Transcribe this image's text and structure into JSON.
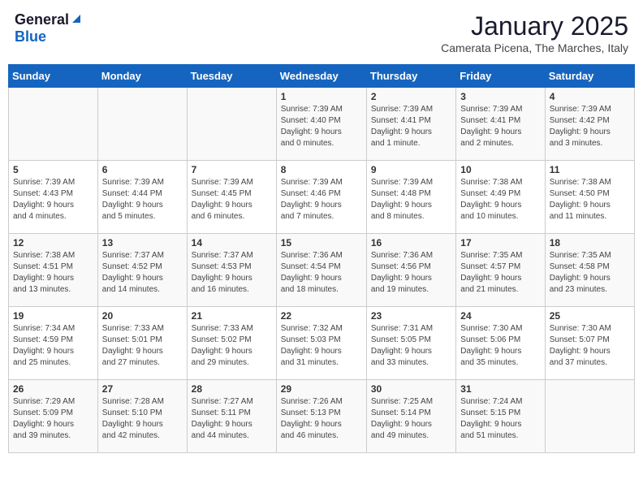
{
  "header": {
    "logo_general": "General",
    "logo_blue": "Blue",
    "title": "January 2025",
    "subtitle": "Camerata Picena, The Marches, Italy"
  },
  "weekdays": [
    "Sunday",
    "Monday",
    "Tuesday",
    "Wednesday",
    "Thursday",
    "Friday",
    "Saturday"
  ],
  "weeks": [
    [
      {
        "day": "",
        "info": ""
      },
      {
        "day": "",
        "info": ""
      },
      {
        "day": "",
        "info": ""
      },
      {
        "day": "1",
        "info": "Sunrise: 7:39 AM\nSunset: 4:40 PM\nDaylight: 9 hours\nand 0 minutes."
      },
      {
        "day": "2",
        "info": "Sunrise: 7:39 AM\nSunset: 4:41 PM\nDaylight: 9 hours\nand 1 minute."
      },
      {
        "day": "3",
        "info": "Sunrise: 7:39 AM\nSunset: 4:41 PM\nDaylight: 9 hours\nand 2 minutes."
      },
      {
        "day": "4",
        "info": "Sunrise: 7:39 AM\nSunset: 4:42 PM\nDaylight: 9 hours\nand 3 minutes."
      }
    ],
    [
      {
        "day": "5",
        "info": "Sunrise: 7:39 AM\nSunset: 4:43 PM\nDaylight: 9 hours\nand 4 minutes."
      },
      {
        "day": "6",
        "info": "Sunrise: 7:39 AM\nSunset: 4:44 PM\nDaylight: 9 hours\nand 5 minutes."
      },
      {
        "day": "7",
        "info": "Sunrise: 7:39 AM\nSunset: 4:45 PM\nDaylight: 9 hours\nand 6 minutes."
      },
      {
        "day": "8",
        "info": "Sunrise: 7:39 AM\nSunset: 4:46 PM\nDaylight: 9 hours\nand 7 minutes."
      },
      {
        "day": "9",
        "info": "Sunrise: 7:39 AM\nSunset: 4:48 PM\nDaylight: 9 hours\nand 8 minutes."
      },
      {
        "day": "10",
        "info": "Sunrise: 7:38 AM\nSunset: 4:49 PM\nDaylight: 9 hours\nand 10 minutes."
      },
      {
        "day": "11",
        "info": "Sunrise: 7:38 AM\nSunset: 4:50 PM\nDaylight: 9 hours\nand 11 minutes."
      }
    ],
    [
      {
        "day": "12",
        "info": "Sunrise: 7:38 AM\nSunset: 4:51 PM\nDaylight: 9 hours\nand 13 minutes."
      },
      {
        "day": "13",
        "info": "Sunrise: 7:37 AM\nSunset: 4:52 PM\nDaylight: 9 hours\nand 14 minutes."
      },
      {
        "day": "14",
        "info": "Sunrise: 7:37 AM\nSunset: 4:53 PM\nDaylight: 9 hours\nand 16 minutes."
      },
      {
        "day": "15",
        "info": "Sunrise: 7:36 AM\nSunset: 4:54 PM\nDaylight: 9 hours\nand 18 minutes."
      },
      {
        "day": "16",
        "info": "Sunrise: 7:36 AM\nSunset: 4:56 PM\nDaylight: 9 hours\nand 19 minutes."
      },
      {
        "day": "17",
        "info": "Sunrise: 7:35 AM\nSunset: 4:57 PM\nDaylight: 9 hours\nand 21 minutes."
      },
      {
        "day": "18",
        "info": "Sunrise: 7:35 AM\nSunset: 4:58 PM\nDaylight: 9 hours\nand 23 minutes."
      }
    ],
    [
      {
        "day": "19",
        "info": "Sunrise: 7:34 AM\nSunset: 4:59 PM\nDaylight: 9 hours\nand 25 minutes."
      },
      {
        "day": "20",
        "info": "Sunrise: 7:33 AM\nSunset: 5:01 PM\nDaylight: 9 hours\nand 27 minutes."
      },
      {
        "day": "21",
        "info": "Sunrise: 7:33 AM\nSunset: 5:02 PM\nDaylight: 9 hours\nand 29 minutes."
      },
      {
        "day": "22",
        "info": "Sunrise: 7:32 AM\nSunset: 5:03 PM\nDaylight: 9 hours\nand 31 minutes."
      },
      {
        "day": "23",
        "info": "Sunrise: 7:31 AM\nSunset: 5:05 PM\nDaylight: 9 hours\nand 33 minutes."
      },
      {
        "day": "24",
        "info": "Sunrise: 7:30 AM\nSunset: 5:06 PM\nDaylight: 9 hours\nand 35 minutes."
      },
      {
        "day": "25",
        "info": "Sunrise: 7:30 AM\nSunset: 5:07 PM\nDaylight: 9 hours\nand 37 minutes."
      }
    ],
    [
      {
        "day": "26",
        "info": "Sunrise: 7:29 AM\nSunset: 5:09 PM\nDaylight: 9 hours\nand 39 minutes."
      },
      {
        "day": "27",
        "info": "Sunrise: 7:28 AM\nSunset: 5:10 PM\nDaylight: 9 hours\nand 42 minutes."
      },
      {
        "day": "28",
        "info": "Sunrise: 7:27 AM\nSunset: 5:11 PM\nDaylight: 9 hours\nand 44 minutes."
      },
      {
        "day": "29",
        "info": "Sunrise: 7:26 AM\nSunset: 5:13 PM\nDaylight: 9 hours\nand 46 minutes."
      },
      {
        "day": "30",
        "info": "Sunrise: 7:25 AM\nSunset: 5:14 PM\nDaylight: 9 hours\nand 49 minutes."
      },
      {
        "day": "31",
        "info": "Sunrise: 7:24 AM\nSunset: 5:15 PM\nDaylight: 9 hours\nand 51 minutes."
      },
      {
        "day": "",
        "info": ""
      }
    ]
  ]
}
